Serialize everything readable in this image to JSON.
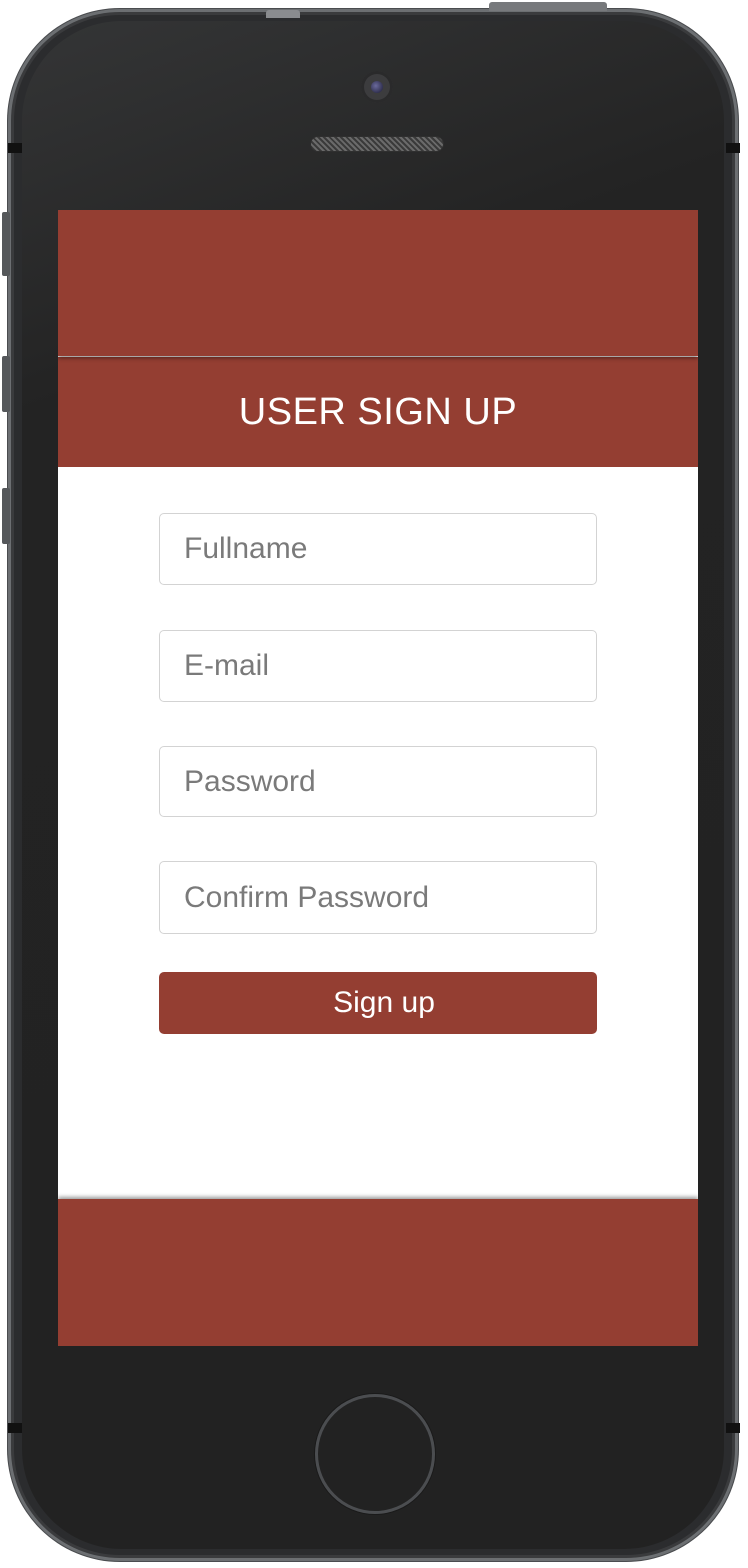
{
  "header": {
    "title": "USER SIGN UP"
  },
  "form": {
    "fullname": {
      "value": "",
      "placeholder": "Fullname"
    },
    "email": {
      "value": "",
      "placeholder": "E-mail"
    },
    "password": {
      "value": "",
      "placeholder": "Password"
    },
    "confirm_password": {
      "value": "",
      "placeholder": "Confirm Password"
    },
    "submit_label": "Sign up"
  },
  "colors": {
    "accent": "#943e32",
    "device_body": "#222222",
    "field_border": "#d3d3d3",
    "placeholder": "#7a7a7a"
  },
  "icons": {
    "camera": "front-camera-icon",
    "speaker": "speaker-grille-icon",
    "home": "home-button-icon"
  }
}
